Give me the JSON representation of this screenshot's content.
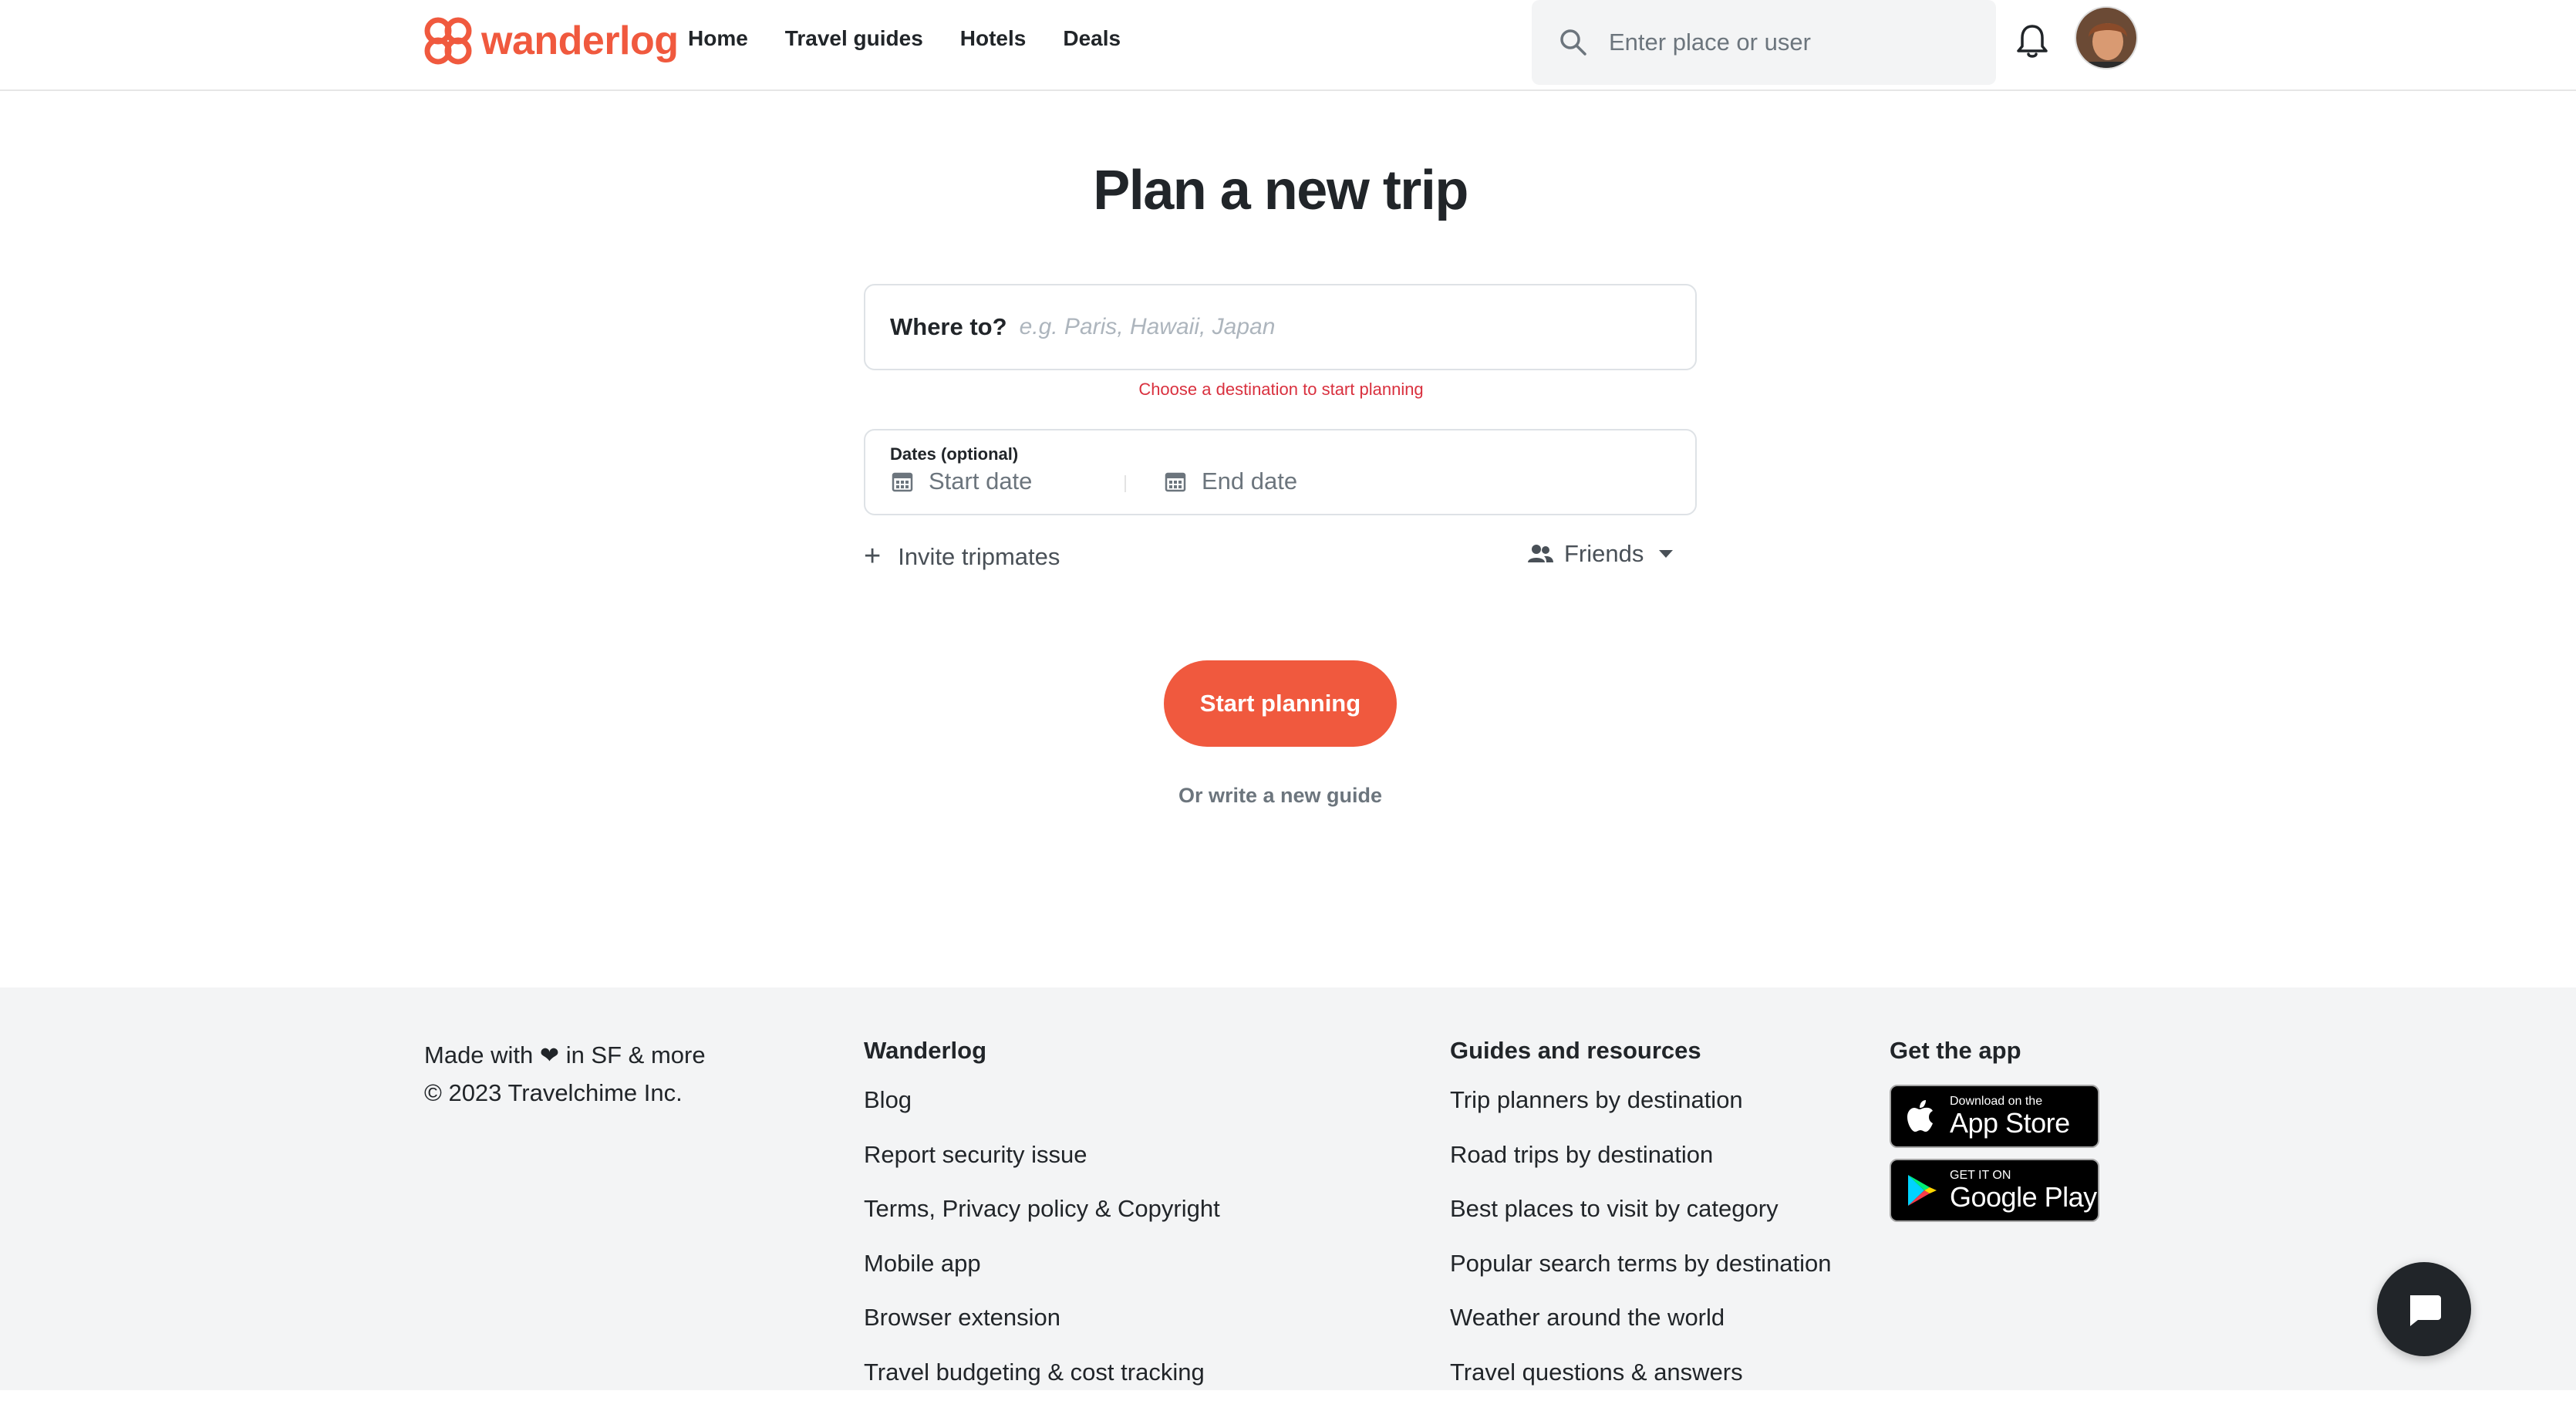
{
  "header": {
    "logo_text": "wanderlog",
    "nav": [
      "Home",
      "Travel guides",
      "Hotels",
      "Deals"
    ],
    "search_placeholder": "Enter place or user"
  },
  "main": {
    "title": "Plan a new trip",
    "where_label": "Where to?",
    "where_placeholder": "e.g. Paris, Hawaii, Japan",
    "error_text": "Choose a destination to start planning",
    "dates_label": "Dates (optional)",
    "start_date": "Start date",
    "end_date": "End date",
    "invite_text": "Invite tripmates",
    "friends_text": "Friends",
    "start_button": "Start planning",
    "guide_link": "Or write a new guide"
  },
  "footer": {
    "made_with_prefix": "Made with",
    "made_with_suffix": "in SF & more",
    "copyright": "© 2023 Travelchime Inc.",
    "wanderlog_heading": "Wanderlog",
    "wanderlog_links": [
      "Blog",
      "Report security issue",
      "Terms, Privacy policy & Copyright",
      "Mobile app",
      "Browser extension",
      "Travel budgeting & cost tracking"
    ],
    "guides_heading": "Guides and resources",
    "guides_links": [
      "Trip planners by destination",
      "Road trips by destination",
      "Best places to visit by category",
      "Popular search terms by destination",
      "Weather around the world",
      "Travel questions & answers"
    ],
    "app_heading": "Get the app",
    "app_store_small": "Download on the",
    "app_store_big": "App Store",
    "google_small": "GET IT ON",
    "google_big": "Google Play"
  },
  "colors": {
    "brand": "#f0593e",
    "error": "#d9303e",
    "footer_bg": "#f3f4f5"
  },
  "icons": [
    "wanderlog-logo-icon",
    "search-icon",
    "bell-icon",
    "calendar-icon",
    "plus-icon",
    "people-icon",
    "apple-icon",
    "google-play-icon",
    "chat-icon"
  ]
}
